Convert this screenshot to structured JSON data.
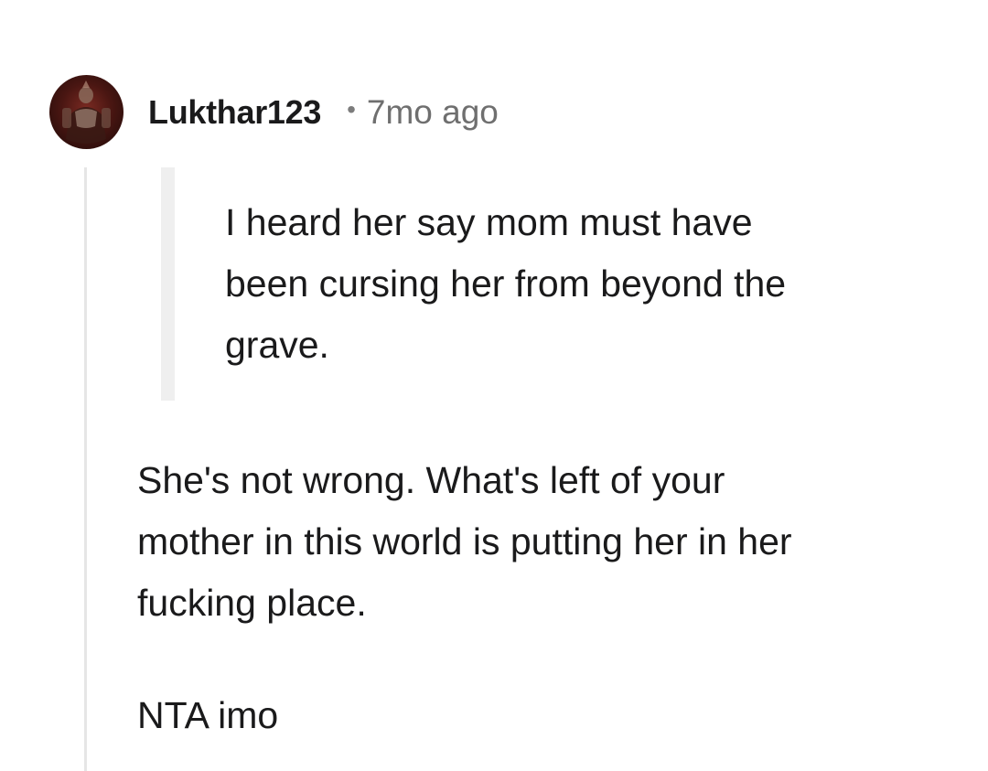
{
  "comment": {
    "author": "Lukthar123",
    "separator": "•",
    "timestamp": "7mo ago",
    "avatar_icon": "user-avatar",
    "quote": {
      "lines": [
        "I heard her say mom must have",
        "been cursing her from beyond the",
        "grave."
      ]
    },
    "body": {
      "lines": [
        "She's not wrong. What's left of your",
        "mother in this world is putting her in her",
        "fucking place."
      ]
    },
    "closing": "NTA imo"
  }
}
